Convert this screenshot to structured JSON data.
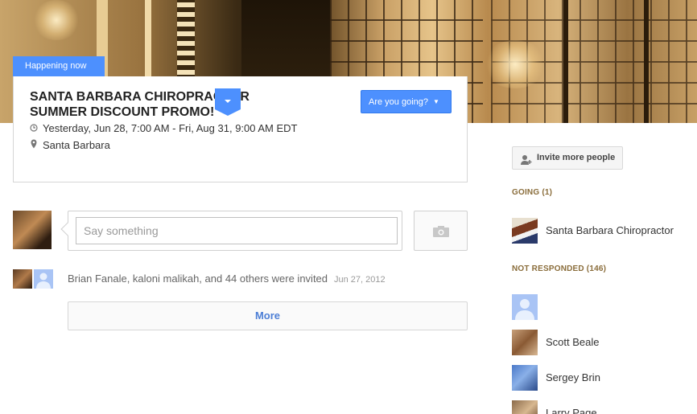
{
  "banner": {
    "badge": "Happening now"
  },
  "event": {
    "title_line1": "SANTA BARBARA CHIROPRACTOR",
    "title_line2": "SUMMER DISCOUNT PROMO!",
    "rsvp_label": "Are you going?",
    "datetime": "Yesterday, Jun 28, 7:00 AM - Fri, Aug 31, 9:00 AM EDT",
    "location": "Santa Barbara",
    "icons": {
      "time": "clock-icon",
      "place": "location-pin-icon",
      "expand": "chevron-down-icon"
    }
  },
  "composer": {
    "placeholder": "Say something",
    "photo_icon": "camera-icon"
  },
  "activity": {
    "text": "Brian Fanale, kaloni malikah, and 44 others were invited",
    "date": "Jun 27, 2012"
  },
  "more_label": "More",
  "sidebar": {
    "invite_label": "Invite more people",
    "going_header": "GOING (1)",
    "going": [
      {
        "name": "Santa Barbara Chiropractor"
      }
    ],
    "not_responded_header": "NOT RESPONDED (146)",
    "not_responded": [
      {
        "name": ""
      },
      {
        "name": "Scott Beale"
      },
      {
        "name": "Sergey Brin"
      },
      {
        "name": "Larry Page"
      }
    ]
  },
  "colors": {
    "accent": "#4d90fe",
    "section_header": "#8a6d3b",
    "link": "#4d7fd6"
  }
}
